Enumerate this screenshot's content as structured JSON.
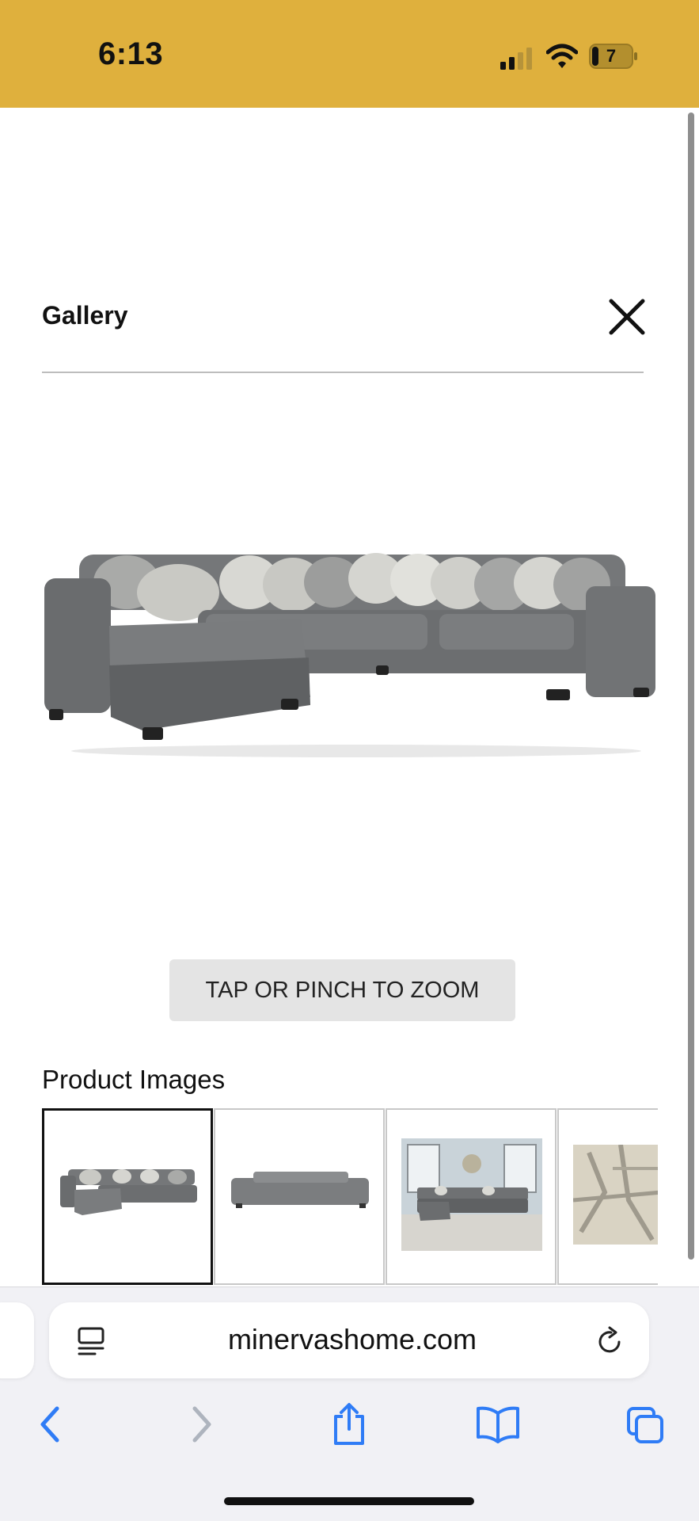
{
  "status_bar": {
    "time": "6:13",
    "battery_level": "7",
    "background_color": "#DFB03D",
    "icons": [
      "signal-icon",
      "wifi-icon",
      "battery-icon"
    ]
  },
  "gallery": {
    "title": "Gallery",
    "close_icon": "close-icon",
    "main_image": "sectional-sofa-image",
    "zoom_hint": "TAP OR PINCH TO ZOOM"
  },
  "product_images": {
    "label": "Product Images",
    "thumbnails": [
      {
        "subject": "sectional-front-view",
        "selected": true
      },
      {
        "subject": "sectional-back-view",
        "selected": false
      },
      {
        "subject": "sectional-room-scene",
        "selected": false
      },
      {
        "subject": "fabric-swatch",
        "selected": false
      }
    ]
  },
  "browser": {
    "url": "minervashome.com",
    "icons": [
      "page-menu-icon",
      "reload-icon",
      "back-icon",
      "forward-icon",
      "share-icon",
      "bookmarks-icon",
      "tabs-icon"
    ],
    "accent_color": "#2F7CF6",
    "disabled_color": "#AEB4BE"
  }
}
